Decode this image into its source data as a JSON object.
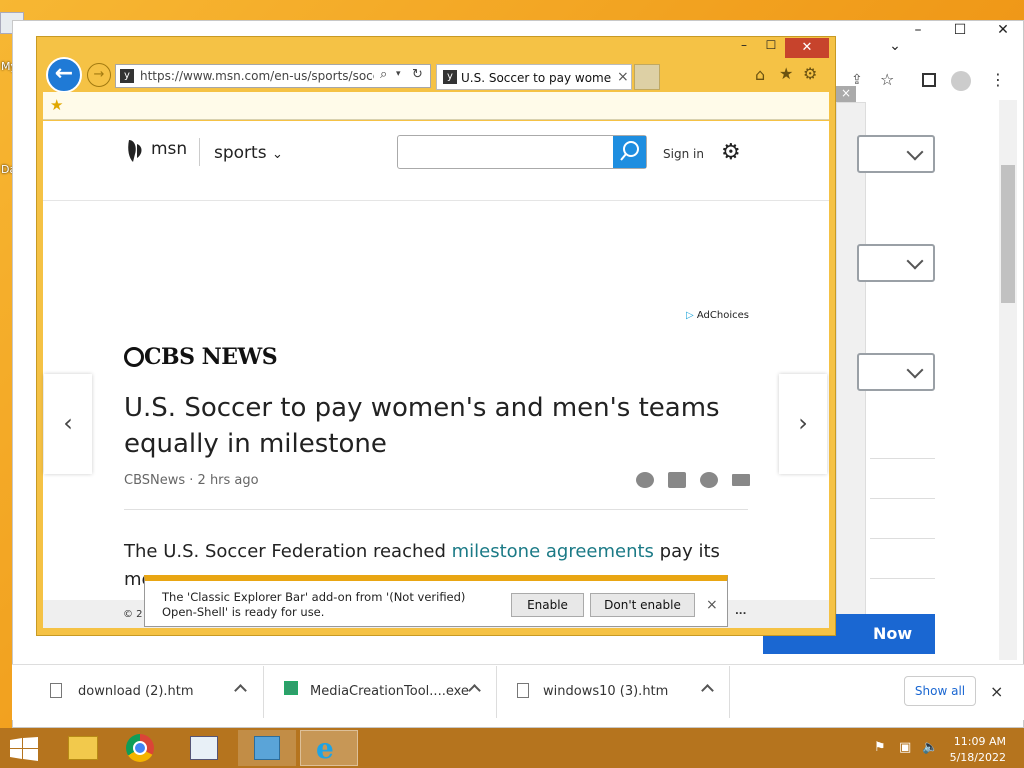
{
  "ie": {
    "address_url": "https://www.msn.com/en-us/sports/soccer/",
    "tab_title": "U.S. Soccer to pay women's...",
    "tab_close": "×"
  },
  "msn": {
    "brand": "msn",
    "section": "sports",
    "search_placeholder": "",
    "sign_in": "Sign in",
    "adchoices": "AdChoices",
    "source_logo": "CBS NEWS",
    "headline": "U.S. Soccer to pay women's and men's teams equally in milestone",
    "byline": "CBSNews · 2 hrs ago",
    "body_prefix": "The U.S. Soccer Federation reached ",
    "body_link": "milestone agreements",
    "body_suffix": " pay its",
    "body_line2_start": "me",
    "status_left": "© 2",
    "status_right": "..."
  },
  "notification": {
    "text": "The 'Classic Explorer Bar' add-on from '(Not verified) Open-Shell' is ready for use.",
    "enable": "Enable",
    "dont_enable": "Don't enable",
    "close": "×"
  },
  "chrome": {
    "now_button": "Now",
    "downloads": [
      {
        "name": "download (2).htm"
      },
      {
        "name": "MediaCreationTool....exe"
      },
      {
        "name": "windows10 (3).htm"
      }
    ],
    "show_all": "Show all",
    "close_bar": "×"
  },
  "desktop": {
    "labels": [
      "My",
      "Dat"
    ]
  },
  "taskbar": {
    "time": "11:09 AM",
    "date": "5/18/2022"
  },
  "colors": {
    "ie_frame": "#f5c245",
    "accent_blue": "#1a67d2",
    "taskbar": "#b5741e"
  }
}
